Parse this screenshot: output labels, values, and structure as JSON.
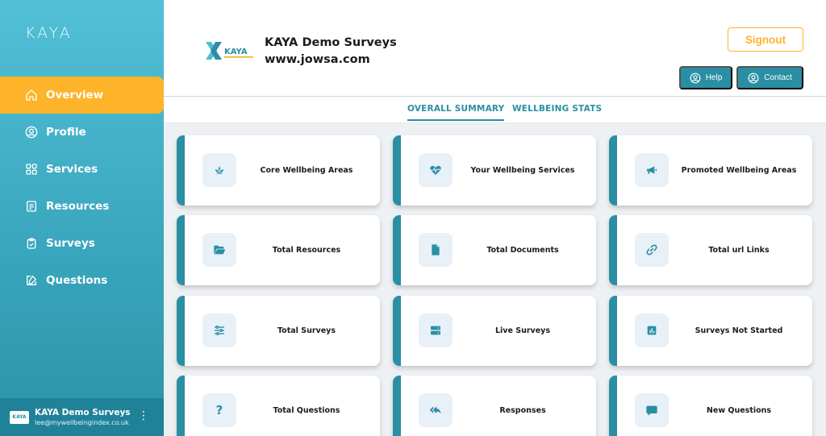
{
  "sidebar": {
    "brand": "KAYA",
    "items": [
      {
        "label": "Overview",
        "icon": "home-icon",
        "active": true
      },
      {
        "label": "Profile",
        "icon": "user-circle-icon",
        "active": false
      },
      {
        "label": "Services",
        "icon": "grid-icon",
        "active": false
      },
      {
        "label": "Resources",
        "icon": "document-icon",
        "active": false
      },
      {
        "label": "Surveys",
        "icon": "clipboard-icon",
        "active": false
      },
      {
        "label": "Questions",
        "icon": "edit-icon",
        "active": false
      }
    ],
    "footer": {
      "logo_text": "KAYA",
      "name": "KAYA Demo Surveys",
      "email": "lee@mywellbeingindex.co.uk",
      "menu_icon": "more-vertical-icon"
    }
  },
  "header": {
    "logo_text": "KAYA",
    "title": "KAYA Demo Surveys",
    "url": "www.jowsa.com",
    "signout_label": "Signout",
    "help_label": "Help",
    "contact_label": "Contact"
  },
  "tabs": [
    {
      "label": "OVERALL SUMMARY",
      "active": true
    },
    {
      "label": "WELLBEING STATS",
      "active": false
    }
  ],
  "cards": [
    {
      "label": "Core Wellbeing Areas",
      "icon": "lotus-icon"
    },
    {
      "label": "Your Wellbeing Services",
      "icon": "heartbeat-icon"
    },
    {
      "label": "Promoted Wellbeing Areas",
      "icon": "megaphone-icon"
    },
    {
      "label": "Total Resources",
      "icon": "folder-open-icon"
    },
    {
      "label": "Total Documents",
      "icon": "file-icon"
    },
    {
      "label": "Total url Links",
      "icon": "link-icon"
    },
    {
      "label": "Total Surveys",
      "icon": "sliders-icon"
    },
    {
      "label": "Live Surveys",
      "icon": "server-icon"
    },
    {
      "label": "Surveys Not Started",
      "icon": "bar-chart-icon"
    },
    {
      "label": "Total Questions",
      "icon": "question-icon",
      "glyph": "?"
    },
    {
      "label": "Responses",
      "icon": "reply-all-icon"
    },
    {
      "label": "New Questions",
      "icon": "comment-icon"
    }
  ],
  "colors": {
    "accent": "#2a8fa3",
    "active_nav": "#fdb42a",
    "sidebar_top": "#52c0d6",
    "sidebar_bottom": "#2b93a8"
  }
}
